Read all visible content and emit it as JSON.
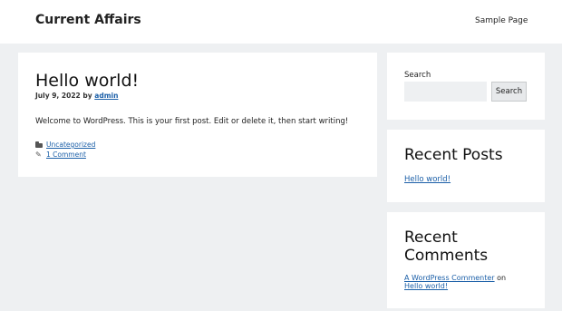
{
  "site": {
    "title": "Current Affairs",
    "nav": [
      "Sample Page"
    ]
  },
  "post": {
    "title": "Hello world!",
    "date": "July 9, 2022",
    "by": "by",
    "author": "admin",
    "content": "Welcome to WordPress. This is your first post. Edit or delete it, then start writing!",
    "category": "Uncategorized",
    "comments": "1 Comment",
    "icons": [
      "folder-icon",
      "tag-icon"
    ]
  },
  "sidebar": {
    "search": {
      "label": "Search",
      "value": "",
      "button": "Search"
    },
    "recent_posts": {
      "title": "Recent Posts",
      "items": [
        "Hello world!"
      ]
    },
    "recent_comments": {
      "title_line1": "Recent",
      "title_line2": "Comments",
      "items": [
        {
          "author": "A WordPress Commenter",
          "on": "on",
          "post": "Hello world!"
        }
      ]
    }
  },
  "colors": {
    "background": "#eef0f2",
    "link": "#1b5fa8",
    "card": "#ffffff"
  }
}
